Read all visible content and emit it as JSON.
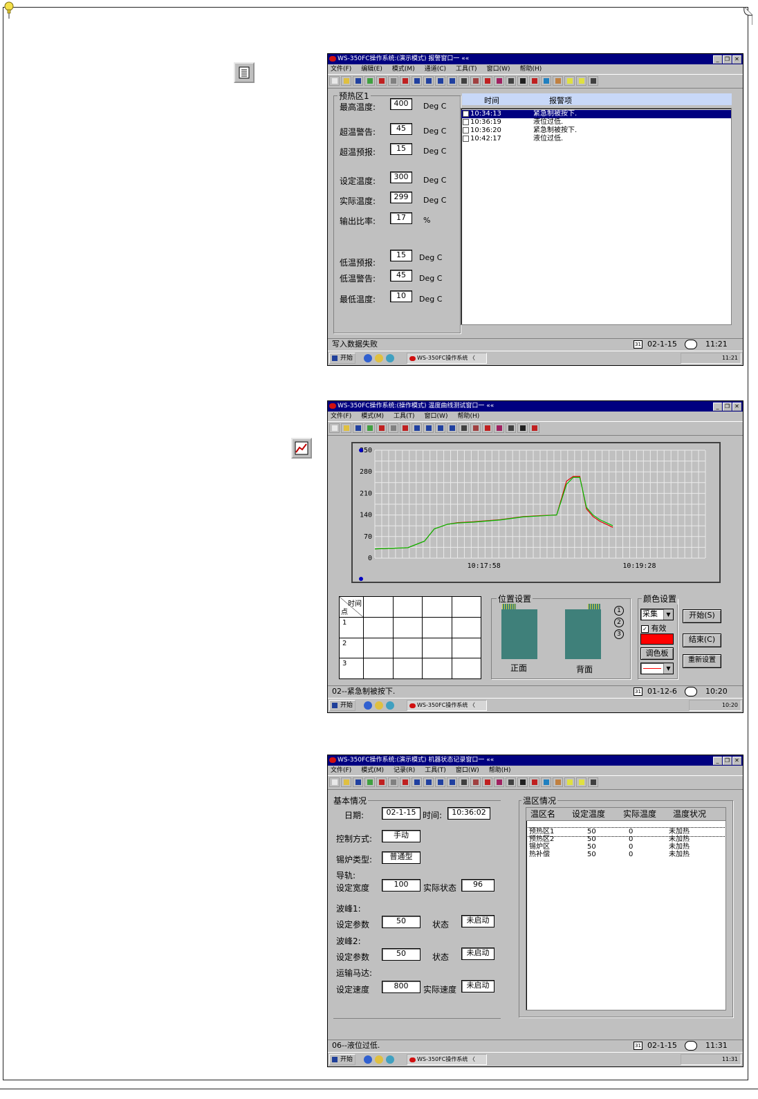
{
  "window1": {
    "title": "WS-350FC操作系统:(演示模式) 报警窗口一 ««",
    "menus": [
      "文件(F)",
      "编辑(E)",
      "模式(M)",
      "通道(C)",
      "工具(T)",
      "窗口(W)",
      "帮助(H)"
    ],
    "group_title": "预热区1",
    "fields": [
      {
        "label": "最高温度:",
        "value": "400",
        "unit": "Deg C"
      },
      {
        "label": "超温警告:",
        "value": "45",
        "unit": "Deg C"
      },
      {
        "label": "超温预报:",
        "value": "15",
        "unit": "Deg C"
      },
      {
        "label": "设定温度:",
        "value": "300",
        "unit": "Deg C"
      },
      {
        "label": "实际温度:",
        "value": "299",
        "unit": "Deg C"
      },
      {
        "label": "输出比率:",
        "value": "17",
        "unit": "%"
      },
      {
        "label": "低温预报:",
        "value": "15",
        "unit": "Deg C"
      },
      {
        "label": "低温警告:",
        "value": "45",
        "unit": "Deg C"
      },
      {
        "label": "最低温度:",
        "value": "10",
        "unit": "Deg C"
      }
    ],
    "alarm_header": {
      "time": "时间",
      "item": "报警项"
    },
    "alarms": [
      {
        "time": "10:34:13",
        "item": "紧急制被按下."
      },
      {
        "time": "10:36:19",
        "item": "液位过低."
      },
      {
        "time": "10:36:20",
        "item": "紧急制被按下."
      },
      {
        "time": "10:42:17",
        "item": "液位过低."
      }
    ],
    "status": "写入数据失败",
    "date": "02-1-15",
    "time": "11:21",
    "taskbar": {
      "start": "开始",
      "task": "WS-350FC操作系统 〈",
      "tray_time": "11:21"
    }
  },
  "window2": {
    "title": "WS-350FC操作系统:(操作模式) 温度曲线测试窗口一 ««",
    "menus": [
      "文件(F)",
      "模式(M)",
      "工具(T)",
      "窗口(W)",
      "帮助(H)"
    ],
    "table_header": {
      "top": "时间",
      "bottom": "点"
    },
    "table_rows": [
      "1",
      "2",
      "3"
    ],
    "position_group": "位置设置",
    "front_label": "正面",
    "back_label": "背面",
    "probe_numbers": [
      "1",
      "2",
      "3"
    ],
    "color_group": "颜色设置",
    "color_select": "采集",
    "valid_label": "有效",
    "palette_btn": "调色板",
    "start_btn": "开始(S)",
    "end_btn": "结束(C)",
    "reset_btn": "重新设置",
    "status": "02--紧急制被按下.",
    "date": "01-12-6",
    "time": "10:20",
    "taskbar": {
      "start": "开始",
      "task": "WS-350FC操作系统 〈",
      "tray_time": "10:20"
    }
  },
  "chart_data": {
    "type": "line",
    "title": "",
    "xlabel": "",
    "ylabel": "",
    "ylim": [
      0,
      350
    ],
    "yticks": [
      0,
      70,
      140,
      210,
      280,
      350
    ],
    "xtick_labels": [
      "10:17:58",
      "10:19:28"
    ],
    "x": [
      0,
      5,
      10,
      15,
      18,
      22,
      25,
      30,
      38,
      45,
      50,
      55,
      58,
      60,
      62,
      64,
      66,
      68,
      72
    ],
    "series": [
      {
        "values": [
          30,
          32,
          34,
          55,
          95,
          110,
          115,
          118,
          125,
          135,
          138,
          140,
          250,
          265,
          265,
          160,
          135,
          120,
          100
        ],
        "color": "#e00000"
      },
      {
        "values": [
          30,
          32,
          34,
          55,
          95,
          110,
          114,
          117,
          124,
          134,
          137,
          140,
          240,
          262,
          262,
          165,
          140,
          125,
          105
        ],
        "color": "#00c000"
      }
    ],
    "grid": true
  },
  "window3": {
    "title": "WS-350FC操作系统:(演示模式) 机器状态记录窗口一 ««",
    "menus": [
      "文件(F)",
      "模式(M)",
      "记录(R)",
      "工具(T)",
      "窗口(W)",
      "帮助(H)"
    ],
    "basic_group": "基本情况",
    "date_label": "日期:",
    "date_value": "02-1-15",
    "time_label": "时间:",
    "time_value": "10:36:02",
    "control_label": "控制方式:",
    "control_value": "手动",
    "furnace_label": "锡炉类型:",
    "furnace_value": "普通型",
    "rail_label": "导轨:",
    "rail_width_label": "设定宽度",
    "rail_width_value": "100",
    "rail_state_label": "实际状态",
    "rail_state_value": "96",
    "wave1_label": "波峰1:",
    "wave1_param_label": "设定参数",
    "wave1_param_value": "50",
    "wave1_state_label": "状态",
    "wave1_state_value": "未启动",
    "wave2_label": "波峰2:",
    "wave2_param_label": "设定参数",
    "wave2_param_value": "50",
    "wave2_state_label": "状态",
    "wave2_state_value": "未启动",
    "conveyor_label": "运输马达:",
    "conveyor_speed_label": "设定速度",
    "conveyor_speed_value": "800",
    "conveyor_actual_label": "实际速度",
    "conveyor_actual_value": "未启动",
    "zone_group": "温区情况",
    "zone_headers": [
      "温区名",
      "设定温度",
      "实际温度",
      "温度状况"
    ],
    "zones": [
      {
        "name": "预热区1",
        "set": "50",
        "actual": "0",
        "state": "未加热"
      },
      {
        "name": "预热区2",
        "set": "50",
        "actual": "0",
        "state": "未加热"
      },
      {
        "name": "锡炉区",
        "set": "50",
        "actual": "0",
        "state": "未加热"
      },
      {
        "name": "热补偿",
        "set": "50",
        "actual": "0",
        "state": "未加热"
      }
    ],
    "status": "06--液位过低.",
    "date": "02-1-15",
    "time": "11:31",
    "taskbar": {
      "start": "开始",
      "task": "WS-350FC操作系统 〈",
      "tray_time": "11:31"
    }
  }
}
